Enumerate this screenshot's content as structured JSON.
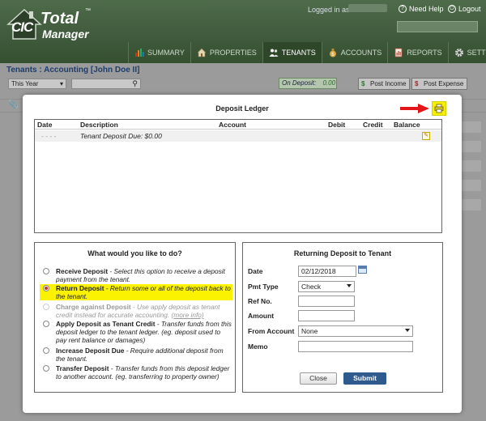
{
  "app": {
    "logo_cic": "CIC",
    "logo_total": "Total",
    "logo_manager": "Manager",
    "logo_tm": "™",
    "logged_in_label": "Logged in as:",
    "need_help": "Need Help",
    "logout": "Logout"
  },
  "nav": {
    "items": [
      {
        "label": "SUMMARY",
        "icon": "bar-chart-icon",
        "color": "#c0392b"
      },
      {
        "label": "PROPERTIES",
        "icon": "house-icon",
        "color": "#e1d6b0"
      },
      {
        "label": "TENANTS",
        "icon": "people-icon",
        "color": "#ffffff"
      },
      {
        "label": "ACCOUNTS",
        "icon": "money-bag-icon",
        "color": "#d9a441"
      },
      {
        "label": "REPORTS",
        "icon": "report-icon",
        "color": "#b54a3c"
      },
      {
        "label": "SETTINGS",
        "icon": "gear-icon",
        "color": "#cccccc"
      }
    ],
    "active": "TENANTS"
  },
  "background": {
    "breadcrumb": "Tenants : Accounting [John Doe II]",
    "period": "This Year",
    "on_deposit_label": "On Deposit:",
    "on_deposit_value": "0.00",
    "post_income": "Post Income",
    "post_expense": "Post Expense",
    "dollar_symbol": "$"
  },
  "modal": {
    "title": "Deposit Ledger",
    "ledger": {
      "columns": [
        "Date",
        "Description",
        "Account",
        "Debit",
        "Credit",
        "Balance"
      ],
      "rows": [
        {
          "date": "- - - -",
          "description": "Tenant Deposit Due: $0.00"
        }
      ]
    },
    "options": {
      "title": "What would you like to do?",
      "items": [
        {
          "label": "Receive Deposit",
          "desc": " - Select this option to receive a deposit payment from the tenant.",
          "selected": false,
          "disabled": false
        },
        {
          "label": "Return Deposit",
          "desc": " - Return some or all of the deposit back to the tenant.",
          "selected": true,
          "disabled": false
        },
        {
          "label": "Charge against Deposit",
          "desc": " - Use apply deposit as tenant credit instead for accurate accounting. ",
          "more": "(more info)",
          "selected": false,
          "disabled": true
        },
        {
          "label": "Apply Deposit as Tenant Credit",
          "desc": " - Transfer funds from this deposit ledger to the tenant ledger. (eg. deposit used to pay rent balance or damages)",
          "selected": false,
          "disabled": false
        },
        {
          "label": "Increase Deposit Due",
          "desc": " - Require additional deposit from the tenant.",
          "selected": false,
          "disabled": false
        },
        {
          "label": "Transfer Deposit",
          "desc": " - Transfer funds from this deposit ledger to another account. (eg. transferring to property owner)",
          "selected": false,
          "disabled": false
        }
      ]
    },
    "form": {
      "title": "Returning Deposit to Tenant",
      "date_label": "Date",
      "date_value": "02/12/2018",
      "pmt_type_label": "Pmt Type",
      "pmt_type_value": "Check",
      "ref_label": "Ref No.",
      "ref_value": "",
      "amount_label": "Amount",
      "amount_value": "",
      "from_account_label": "From Account",
      "from_account_value": "None",
      "memo_label": "Memo",
      "memo_value": "",
      "close_label": "Close",
      "submit_label": "Submit"
    }
  },
  "colors": {
    "highlight": "#faf200",
    "arrow": "#e3151a",
    "submit": "#2f5a8e",
    "header": "#3f5a3c"
  }
}
